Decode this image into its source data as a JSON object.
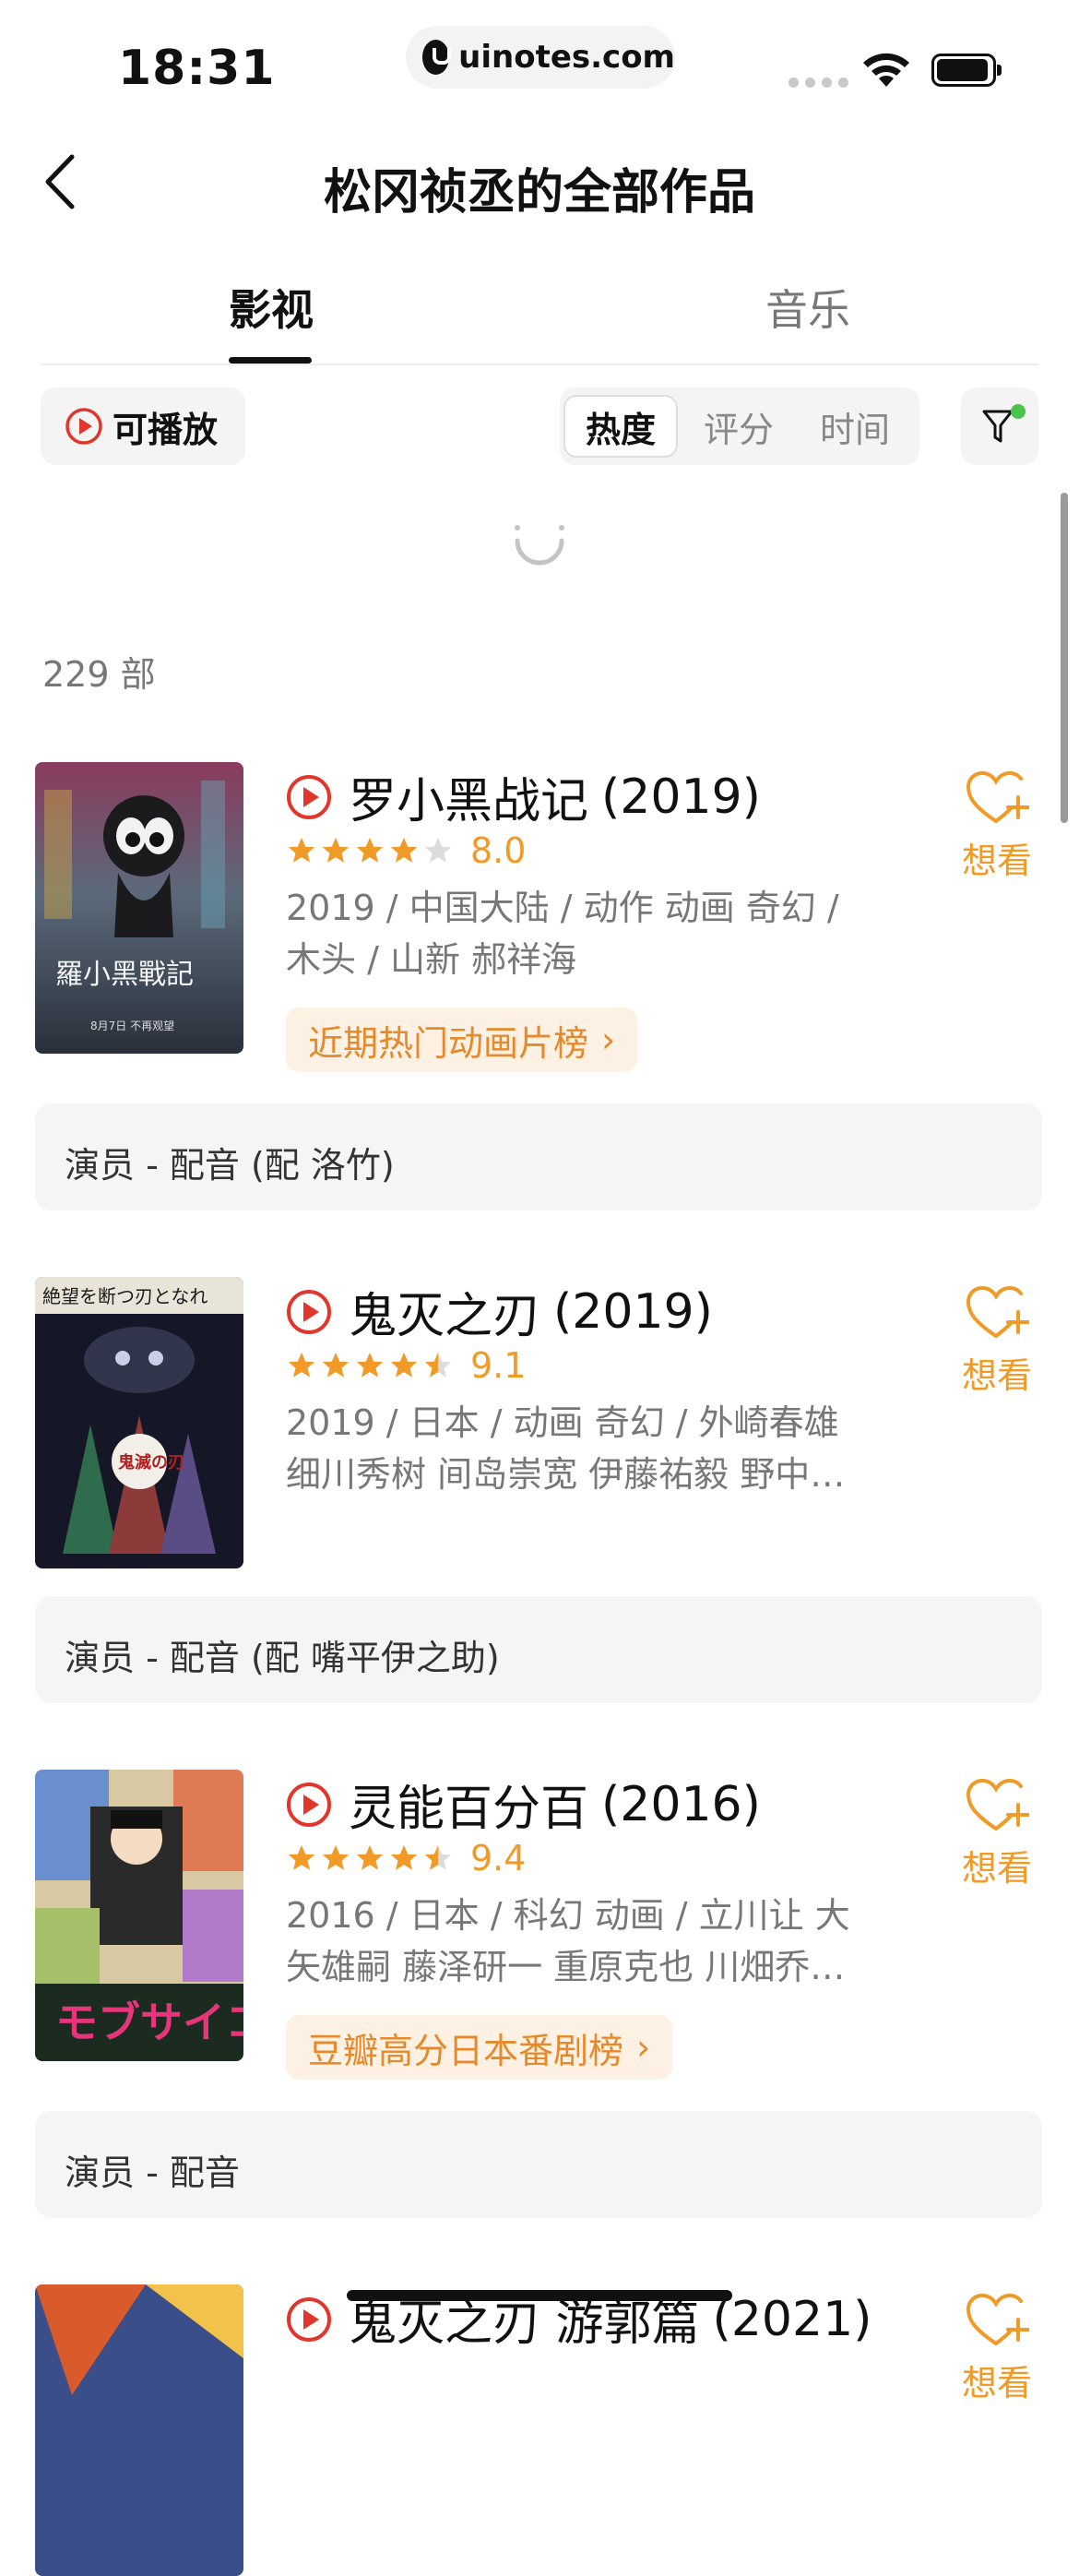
{
  "status_bar": {
    "time": "18:31",
    "url": "uinotes.com"
  },
  "nav": {
    "title": "松冈祯丞的全部作品"
  },
  "tabs": [
    {
      "label": "影视",
      "active": true
    },
    {
      "label": "音乐",
      "active": false
    }
  ],
  "filters": {
    "playable_label": "可播放",
    "sort_options": [
      {
        "label": "热度",
        "active": true
      },
      {
        "label": "评分",
        "active": false
      },
      {
        "label": "时间",
        "active": false
      }
    ],
    "filter_active": true
  },
  "count_text": "229 部",
  "colors": {
    "accent": "#f09a27",
    "play_red": "#e1362b",
    "tag_bg": "#fdf1e3",
    "tag_text": "#e6892b",
    "filter_dot": "#4cc44c"
  },
  "movies": [
    {
      "title": "罗小黑战记",
      "year": "(2019)",
      "rating": "8.0",
      "rating_stars": 4,
      "meta_line1": "2019 / 中国大陆 / 动作 动画 奇幻 /",
      "meta_line2": "木头 / 山新 郝祥海",
      "rank_tag": "近期热门动画片榜",
      "want_label": "想看",
      "role": "演员 - 配音 (配 洛竹)"
    },
    {
      "title": "鬼灭之刃",
      "year": "(2019)",
      "rating": "9.1",
      "rating_stars": 4.5,
      "meta_line1": "2019 / 日本 / 动画 奇幻 / 外崎春雄",
      "meta_line2": "细川秀树 间岛崇宽 伊藤祐毅 野中…",
      "rank_tag": "",
      "want_label": "想看",
      "role": "演员 - 配音 (配 嘴平伊之助)"
    },
    {
      "title": "灵能百分百",
      "year": "(2016)",
      "rating": "9.4",
      "rating_stars": 4.5,
      "meta_line1": "2016 / 日本 / 科幻 动画 / 立川让 大",
      "meta_line2": "矢雄嗣 藤泽研一 重原克也 川畑乔…",
      "rank_tag": "豆瓣高分日本番剧榜",
      "want_label": "想看",
      "role": "演员 - 配音"
    },
    {
      "title": "鬼灭之刃 游郭篇",
      "year": "(2021)",
      "want_label": "想看"
    }
  ]
}
